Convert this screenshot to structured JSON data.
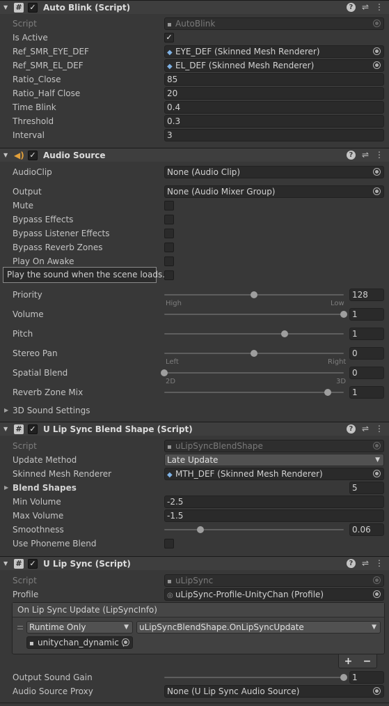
{
  "auto_blink": {
    "title": "Auto Blink (Script)",
    "script_label": "Script",
    "script_value": "AutoBlink",
    "is_active_label": "Is Active",
    "ref_eye_label": "Ref_SMR_EYE_DEF",
    "ref_eye_value": "EYE_DEF (Skinned Mesh Renderer)",
    "ref_el_label": "Ref_SMR_EL_DEF",
    "ref_el_value": "EL_DEF (Skinned Mesh Renderer)",
    "ratio_close_label": "Ratio_Close",
    "ratio_close_value": "85",
    "ratio_half_label": "Ratio_Half Close",
    "ratio_half_value": "20",
    "time_blink_label": "Time Blink",
    "time_blink_value": "0.4",
    "threshold_label": "Threshold",
    "threshold_value": "0.3",
    "interval_label": "Interval",
    "interval_value": "3"
  },
  "audio_source": {
    "title": "Audio Source",
    "audioclip_label": "AudioClip",
    "audioclip_value": "None (Audio Clip)",
    "output_label": "Output",
    "output_value": "None (Audio Mixer Group)",
    "mute_label": "Mute",
    "bypass_effects_label": "Bypass Effects",
    "bypass_listener_label": "Bypass Listener Effects",
    "bypass_reverb_label": "Bypass Reverb Zones",
    "play_on_awake_label": "Play On Awake",
    "tooltip": "Play the sound when the scene loads.",
    "priority_label": "Priority",
    "priority_value": "128",
    "priority_slider": 0.5,
    "priority_min": "High",
    "priority_max": "Low",
    "volume_label": "Volume",
    "volume_value": "1",
    "volume_slider": 1.0,
    "pitch_label": "Pitch",
    "pitch_value": "1",
    "pitch_slider": 0.67,
    "stereo_label": "Stereo Pan",
    "stereo_value": "0",
    "stereo_slider": 0.5,
    "stereo_min": "Left",
    "stereo_max": "Right",
    "spatial_label": "Spatial Blend",
    "spatial_value": "0",
    "spatial_slider": 0.0,
    "spatial_min": "2D",
    "spatial_max": "3D",
    "reverb_mix_label": "Reverb Zone Mix",
    "reverb_mix_value": "1",
    "reverb_mix_slider": 0.91,
    "sound3d_label": "3D Sound Settings"
  },
  "blend_shape": {
    "title": "U Lip Sync Blend Shape (Script)",
    "script_label": "Script",
    "script_value": "uLipSyncBlendShape",
    "update_method_label": "Update Method",
    "update_method_value": "Late Update",
    "skinned_label": "Skinned Mesh Renderer",
    "skinned_value": "MTH_DEF (Skinned Mesh Renderer)",
    "blend_shapes_label": "Blend Shapes",
    "blend_shapes_count": "5",
    "min_volume_label": "Min Volume",
    "min_volume_value": "-2.5",
    "max_volume_label": "Max Volume",
    "max_volume_value": "-1.5",
    "smoothness_label": "Smoothness",
    "smoothness_value": "0.06",
    "smoothness_slider": 0.2,
    "phoneme_label": "Use Phoneme Blend"
  },
  "lip_sync": {
    "title": "U Lip Sync (Script)",
    "script_label": "Script",
    "script_value": "uLipSync",
    "profile_label": "Profile",
    "profile_value": "uLipSync-Profile-UnityChan (Profile)",
    "event_title": "On Lip Sync Update (LipSyncInfo)",
    "runtime_value": "Runtime Only",
    "function_value": "uLipSyncBlendShape.OnLipSyncUpdate",
    "object_value": "unitychan_dynamic (",
    "plus": "+",
    "minus": "−",
    "gain_label": "Output Sound Gain",
    "gain_value": "1",
    "gain_slider": 1.0,
    "proxy_label": "Audio Source Proxy",
    "proxy_value": "None (U Lip Sync Audio Source)"
  }
}
